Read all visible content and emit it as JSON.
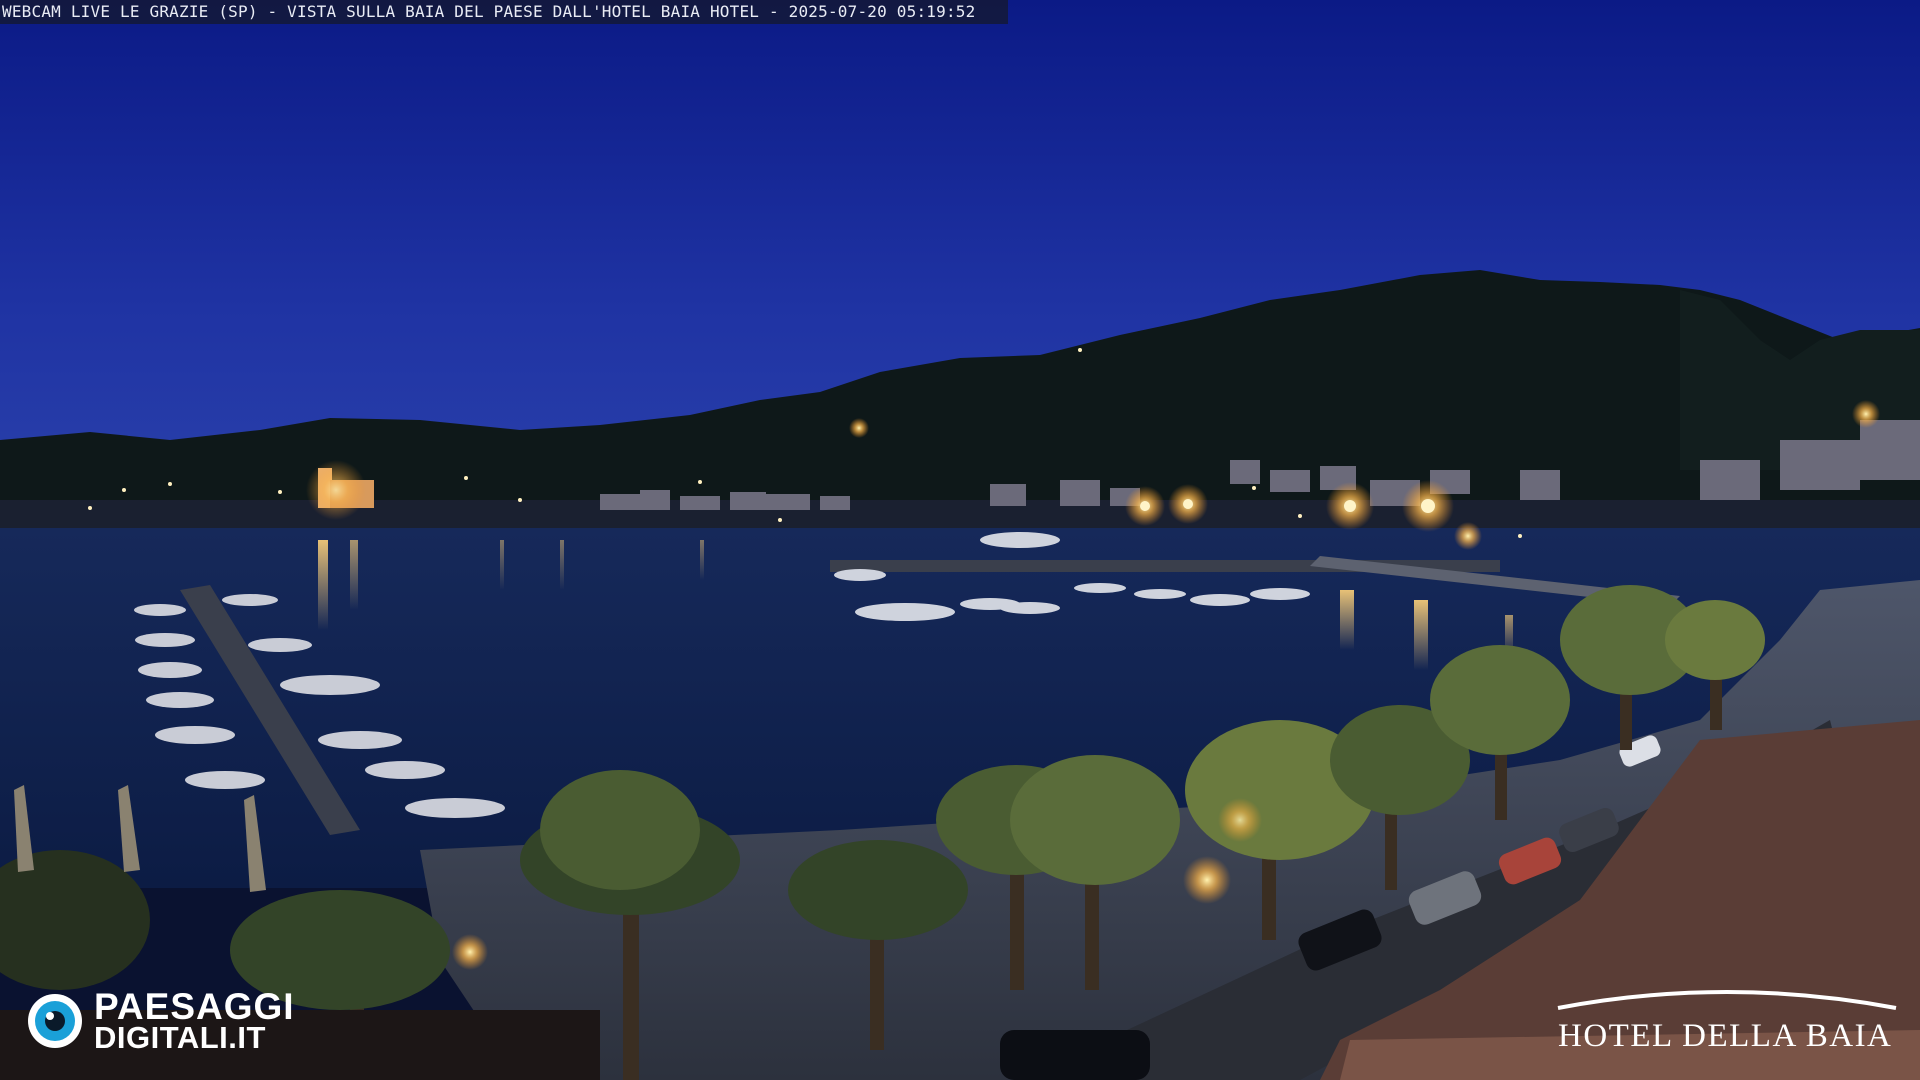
{
  "webcam": {
    "caption": "WEBCAM LIVE LE GRAZIE (SP) - VISTA SULLA BAIA DEL PAESE DALL'HOTEL BAIA HOTEL - 2025-07-20 05:19:52"
  },
  "logos": {
    "left_line1": "PAESAGGI",
    "left_line2_main": "DIGITALI",
    "left_line2_suffix": ".IT",
    "right_text": "HOTEL DELLA BAIA"
  },
  "colors": {
    "sky_top": "#0d1c8c",
    "sky_horizon": "#2a3da8",
    "hill": "#0f1a1c",
    "water": "#0f2452",
    "light": "#ffcc66"
  }
}
